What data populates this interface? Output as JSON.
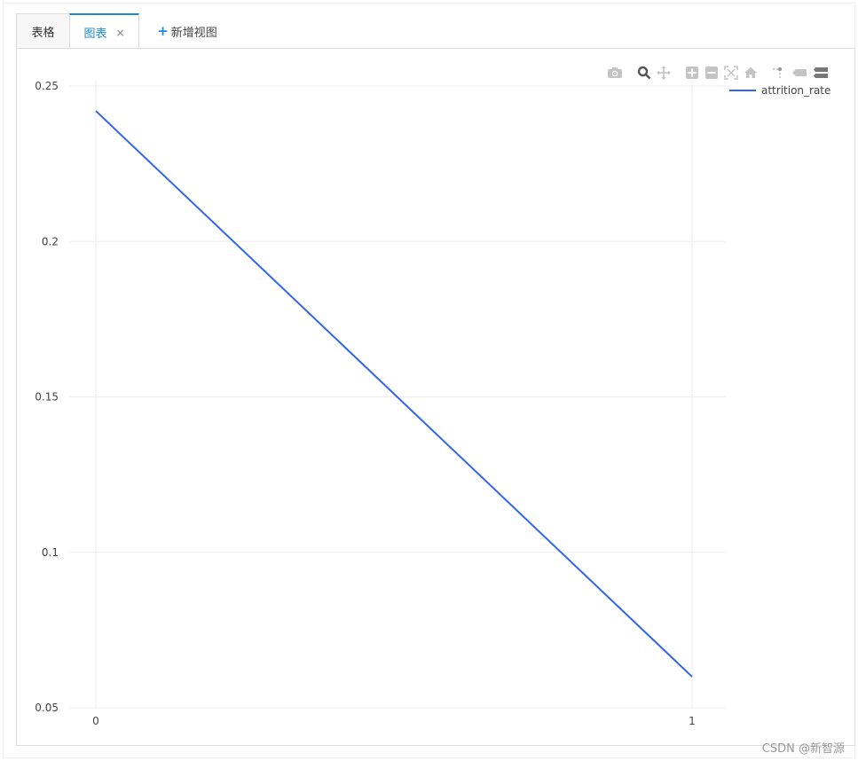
{
  "tabs": {
    "table_label": "表格",
    "chart_label": "图表",
    "close_symbol": "×",
    "add_label": "新增视图",
    "add_symbol": "+"
  },
  "modebar": {
    "icons": [
      "camera-icon",
      "zoom-icon",
      "pan-icon",
      "zoom-in-icon",
      "zoom-out-icon",
      "autoscale-icon",
      "home-icon",
      "spike-lines-icon",
      "hover-closest-icon",
      "hover-compare-icon"
    ]
  },
  "colors": {
    "accent": "#1e88d8",
    "series": "#3366ee",
    "grid": "#eeeeee"
  },
  "chart_data": {
    "type": "line",
    "x": [
      0,
      1
    ],
    "series": [
      {
        "name": "attrition_rate",
        "values": [
          0.242,
          0.06
        ],
        "color": "#3366ee"
      }
    ],
    "xticks": [
      "0",
      "1"
    ],
    "yticks": [
      "0.05",
      "0.1",
      "0.15",
      "0.2",
      "0.25"
    ],
    "xlim": [
      0,
      1
    ],
    "ylim": [
      0.05,
      0.25
    ],
    "grid": true,
    "legend": "top-right"
  },
  "watermark": "CSDN @新智源"
}
